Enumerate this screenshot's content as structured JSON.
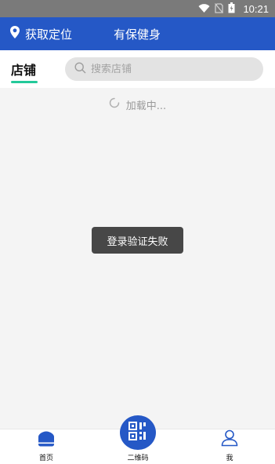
{
  "status_bar": {
    "time": "10:21",
    "icons": [
      "wifi-icon",
      "no-sim-icon",
      "battery-icon"
    ]
  },
  "app_bar": {
    "location_label": "获取定位",
    "title": "有保健身",
    "location_icon": "location-pin-icon"
  },
  "tabs": {
    "active": "店铺"
  },
  "search": {
    "placeholder": "搜索店铺",
    "value": ""
  },
  "loading": {
    "text": "加载中..."
  },
  "toast": {
    "message": "登录验证失败"
  },
  "bottom_nav": {
    "items": [
      {
        "label": "首页",
        "icon": "home-icon"
      },
      {
        "label": "二维码",
        "icon": "qr-code-icon"
      },
      {
        "label": "我",
        "icon": "user-icon"
      }
    ]
  },
  "colors": {
    "brand": "#2558c6",
    "tab_indicator": "#23c99a",
    "toast_bg": "#474747"
  }
}
